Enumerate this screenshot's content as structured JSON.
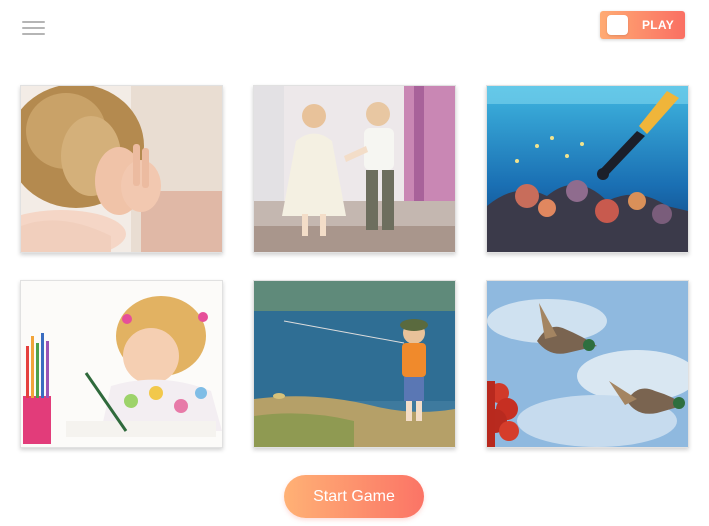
{
  "header": {
    "menu_icon": "hamburger-menu-icon",
    "play_toggle": {
      "label": "PLAY",
      "state": "on",
      "accent": "#fa6f63"
    }
  },
  "gallery": {
    "tiles": [
      {
        "subject": "child-covering-eyes"
      },
      {
        "subject": "children-dancing"
      },
      {
        "subject": "diver-coral-reef"
      },
      {
        "subject": "girl-drawing"
      },
      {
        "subject": "boy-fishing"
      },
      {
        "subject": "ducks-flying"
      }
    ]
  },
  "footer": {
    "start_label": "Start Game",
    "start_color": "#fb7466"
  }
}
